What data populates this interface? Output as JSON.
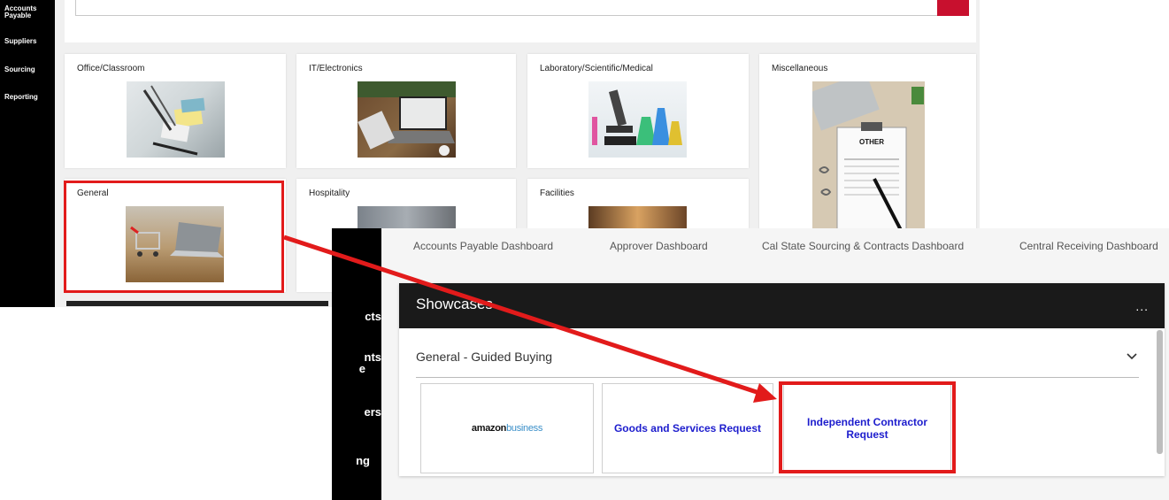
{
  "background_page": {
    "sidebar_items": [
      "Accounts\nPayable",
      "Suppliers",
      "Sourcing",
      "Reporting"
    ],
    "categories": [
      {
        "title": "Office/Classroom"
      },
      {
        "title": "IT/Electronics"
      },
      {
        "title": "Laboratory/Scientific/Medical"
      },
      {
        "title": "Miscellaneous",
        "image_text": "OTHER"
      },
      {
        "title": "General"
      },
      {
        "title": "Hospitality"
      },
      {
        "title": "Facilities"
      }
    ]
  },
  "foreground_page": {
    "sidebar_fragments": [
      "cts",
      "nts",
      "e",
      "ers",
      "ng"
    ],
    "tabs": [
      "Accounts Payable Dashboard",
      "Approver Dashboard",
      "Cal State Sourcing & Contracts Dashboard",
      "Central Receiving Dashboard"
    ],
    "panel": {
      "title": "Showcases",
      "more": "...",
      "section_title": "General - Guided Buying",
      "section_icon": "chevron-down-icon",
      "tiles": [
        {
          "logo_bold": "amazon",
          "logo_light": "business"
        },
        {
          "label": "Goods and Services Request"
        },
        {
          "label": "Independent Contractor Request"
        }
      ]
    }
  },
  "colors": {
    "highlight": "#e21b1b",
    "brand_red": "#c8102e",
    "tile_link": "#1c1ccd",
    "header_dark": "#1a1a1a"
  }
}
